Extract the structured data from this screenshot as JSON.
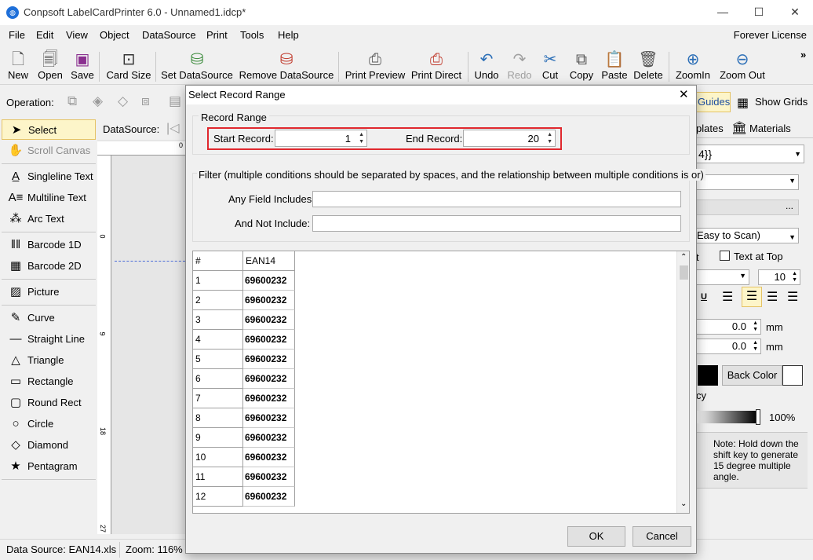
{
  "window": {
    "title": "Conpsoft LabelCardPrinter 6.0 - Unnamed1.idcp*",
    "minimize": "—",
    "maximize": "☐",
    "close": "✕"
  },
  "menu": {
    "items": [
      "File",
      "Edit",
      "View",
      "Object",
      "DataSource",
      "Print",
      "Tools",
      "Help"
    ],
    "license": "Forever License"
  },
  "toolbar": {
    "new": "New",
    "open": "Open",
    "save": "Save",
    "card_size": "Card Size",
    "set_datasource": "Set DataSource",
    "remove_datasource": "Remove DataSource",
    "print_preview": "Print Preview",
    "print_direct": "Print Direct",
    "undo": "Undo",
    "redo": "Redo",
    "cut": "Cut",
    "copy": "Copy",
    "paste": "Paste",
    "delete": "Delete",
    "zoom_in": "ZoomIn",
    "zoom_out": "Zoom Out",
    "more": "»"
  },
  "operation": {
    "label": "Operation:"
  },
  "right_top": {
    "guides": "Guides",
    "show_grids": "Show Grids",
    "templates": "plates",
    "materials": "Materials"
  },
  "tools": [
    "Select",
    "Scroll Canvas",
    "Singleline Text",
    "Multiline Text",
    "Arc Text",
    "Barcode 1D",
    "Barcode 2D",
    "Picture",
    "Curve",
    "Straight Line",
    "Triangle",
    "Rectangle",
    "Round Rect",
    "Circle",
    "Diamond",
    "Pentagram"
  ],
  "canvas": {
    "datasource_label": "DataSource:",
    "ruler_marks": [
      "0",
      "9",
      "18",
      "27"
    ]
  },
  "right_panel": {
    "field_value": "4}}",
    "ellipsis": "...",
    "scan_mode": "Easy to Scan)",
    "t_label": "t",
    "text_at_top": "Text at Top",
    "font_size": "10",
    "underline": "U",
    "x_value": "0.0",
    "y_value": "0.0",
    "unit": "mm",
    "back_color": "Back Color",
    "opacity_label": "cy",
    "opacity_value": "100%",
    "note": "Note: Hold down the shift key to generate 15 degree multiple angle."
  },
  "status": {
    "datasource": "Data Source: EAN14.xls",
    "zoom": "Zoom: 116%"
  },
  "dialog": {
    "title": "Select Record Range",
    "record_range_label": "Record Range",
    "start_label": "Start Record:",
    "start_value": "1",
    "end_label": "End Record:",
    "end_value": "20",
    "filter_label": "Filter (multiple conditions should be separated by spaces, and the relationship between multiple conditions is or)",
    "any_field_label": "Any Field Includes:",
    "any_field_value": "",
    "not_include_label": "And Not Include:",
    "not_include_value": "",
    "grid": {
      "headers": [
        "#",
        "EAN14"
      ],
      "rows": [
        [
          "1",
          "69600232"
        ],
        [
          "2",
          "69600232"
        ],
        [
          "3",
          "69600232"
        ],
        [
          "4",
          "69600232"
        ],
        [
          "5",
          "69600232"
        ],
        [
          "6",
          "69600232"
        ],
        [
          "7",
          "69600232"
        ],
        [
          "8",
          "69600232"
        ],
        [
          "9",
          "69600232"
        ],
        [
          "10",
          "69600232"
        ],
        [
          "11",
          "69600232"
        ],
        [
          "12",
          "69600232"
        ]
      ]
    },
    "ok": "OK",
    "cancel": "Cancel"
  },
  "colors": {
    "highlight_border": "#e0282e",
    "accent": "#1e6fd9",
    "selected_tool": "#fdf5c9"
  }
}
